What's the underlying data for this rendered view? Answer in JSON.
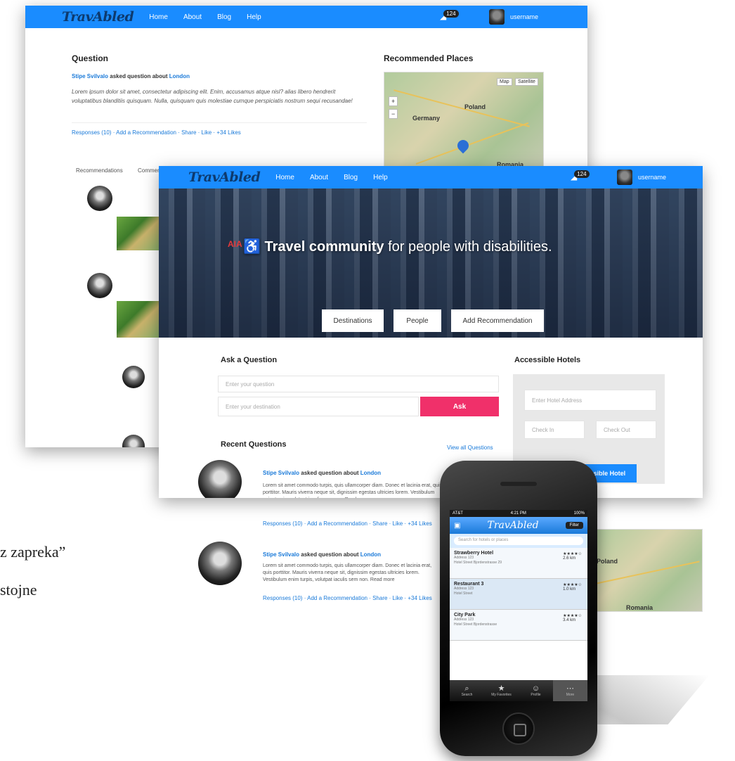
{
  "doc": {
    "line1": "z zapreka”",
    "line2": "stojne"
  },
  "back_screen": {
    "logo": "TravAbled",
    "nav": [
      "Home",
      "About",
      "Blog",
      "Help"
    ],
    "notif_count": "124",
    "username": "username",
    "question": {
      "heading": "Question",
      "asker": "Stipe Svilvalo",
      "asked_text": "asked question about",
      "place": "London",
      "body": "Lorem ipsum dolor sit amet, consectetur adipiscing elit. Enim, accusamus atque nisl? alias libero hendrerit voluptatibus blanditiis quisquam. Nulla, quisquam quis molestiae cumque perspiciatis nostrum sequi recusandae!",
      "meta": "Responses (10) · Add a Recommendation · Share · Like · +34 Likes"
    },
    "recommended": {
      "heading": "Recommended Places",
      "map_buttons": [
        "Map",
        "Satellite"
      ],
      "map_labels": [
        "Poland",
        "Germany",
        "Romania"
      ]
    },
    "tabs": [
      "Recommendations",
      "Comments"
    ]
  },
  "front_screen": {
    "logo": "TravAbled",
    "nav": [
      "Home",
      "About",
      "Blog",
      "Help"
    ],
    "notif_count": "124",
    "username": "username",
    "hero": {
      "brand_sign": "AIA",
      "headline_bold": "Travel community",
      "headline_rest": " for people with disabilities.",
      "buttons": [
        "Destinations",
        "People",
        "Add Recommendation"
      ]
    },
    "ask": {
      "heading": "Ask a Question",
      "question_placeholder": "Enter your question",
      "destination_placeholder": "Enter your destination",
      "ask_label": "Ask"
    },
    "hotels": {
      "heading": "Accessible Hotels",
      "address_placeholder": "Enter Hotel Address",
      "checkin_placeholder": "Check In",
      "checkout_placeholder": "Check Out",
      "search_label": "Search Accessible Hotel"
    },
    "recent": {
      "heading": "Recent Questions",
      "view_all": "View all Questions",
      "items": [
        {
          "asker": "Stipe Svilvalo",
          "asked_text": "asked question about",
          "place": "London",
          "body": "Lorem sit amet commodo turpis, quis ullamcorper diam. Donec et lacinia erat, quis porttitor. Mauris viverra neque sit, dignissim egestas ultricies lorem. Vestibulum enim turpis, volutpat iaculis sem non. Read more",
          "meta": "Responses (10) · Add a Recommendation · Share · Like · +34 Likes"
        },
        {
          "asker": "Stipe Svilvalo",
          "asked_text": "asked question about",
          "place": "London",
          "body": "Lorem sit amet commodo turpis, quis ullamcorper diam. Donec et lacinia erat, quis porttitor. Mauris viverra neque sit, dignissim egestas ultricies lorem. Vestibulum enim turpis, volutpat iaculis sem non. Read more",
          "meta": "Responses (10) · Add a Recommendation · Share · Like · +34 Likes"
        }
      ]
    },
    "map_labels": [
      "Poland",
      "Romania"
    ]
  },
  "phone": {
    "status_left": "AT&T",
    "status_center": "4:21 PM",
    "status_right": "100%",
    "logo": "TravAbled",
    "header_button": "Filter",
    "search_placeholder": "Search for hotels or places",
    "items": [
      {
        "title": "Strawberry Hotel",
        "sub1": "Address 123",
        "sub2": "Hotel Street Bjordenstrasse 29",
        "rating": "★★★★☆",
        "distance": "2.6 km"
      },
      {
        "title": "Restaurant 3",
        "sub1": "Address 123",
        "sub2": "Hotel Street",
        "rating": "★★★★☆",
        "distance": "1.0 km"
      },
      {
        "title": "City Park",
        "sub1": "Address 123",
        "sub2": "Hotel Street Bjordenstrasse",
        "rating": "★★★★☆",
        "distance": "3.4 km"
      }
    ],
    "tabs": [
      {
        "icon": "⌕",
        "label": "Search"
      },
      {
        "icon": "★",
        "label": "My Favorites"
      },
      {
        "icon": "☺",
        "label": "Profile"
      },
      {
        "icon": "⋯",
        "label": "More"
      }
    ]
  },
  "colors": {
    "nav_blue": "#1a8cff",
    "ask_pink": "#f0306a"
  }
}
